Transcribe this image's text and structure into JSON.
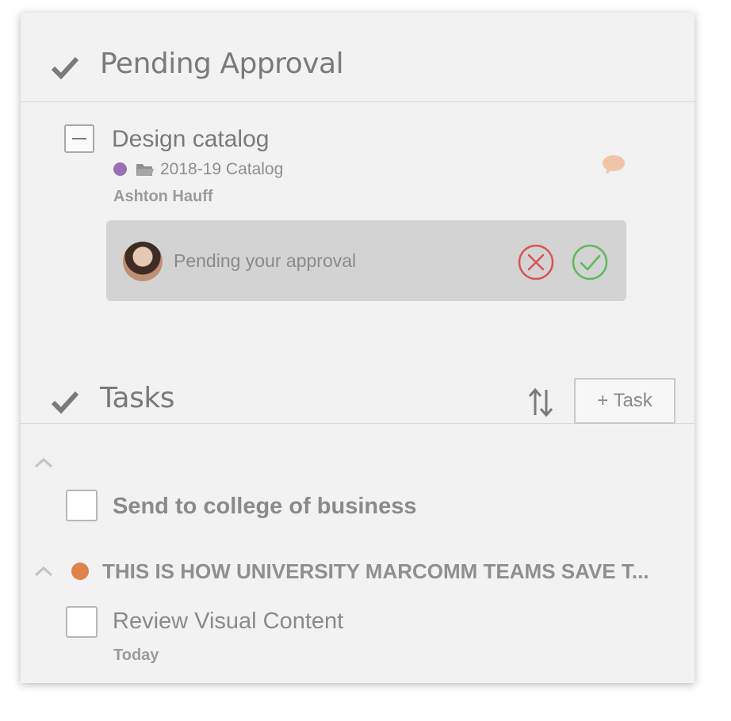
{
  "approval_section": {
    "title": "Pending Approval",
    "item": {
      "title": "Design catalog",
      "project": "2018-19 Catalog",
      "project_color": "#9a6fb5",
      "assignee": "Ashton Hauff",
      "approval_prompt": "Pending your approval",
      "reject_icon": "x-circle-icon",
      "approve_icon": "check-circle-icon"
    }
  },
  "tasks_section": {
    "title": "Tasks",
    "add_task_label": "+ Task",
    "groups": [
      {
        "title": "",
        "tasks": [
          {
            "label": "Send to college of business",
            "checked": false,
            "due": ""
          }
        ]
      },
      {
        "title": "THIS IS HOW UNIVERSITY MARCOMM TEAMS SAVE T...",
        "color": "#e0824a",
        "tasks": [
          {
            "label": "Review Visual Content",
            "checked": false,
            "due": "Today"
          }
        ]
      }
    ]
  },
  "colors": {
    "reject": "#d9534f",
    "approve": "#5cb85c",
    "comment": "#f0c4a8"
  }
}
